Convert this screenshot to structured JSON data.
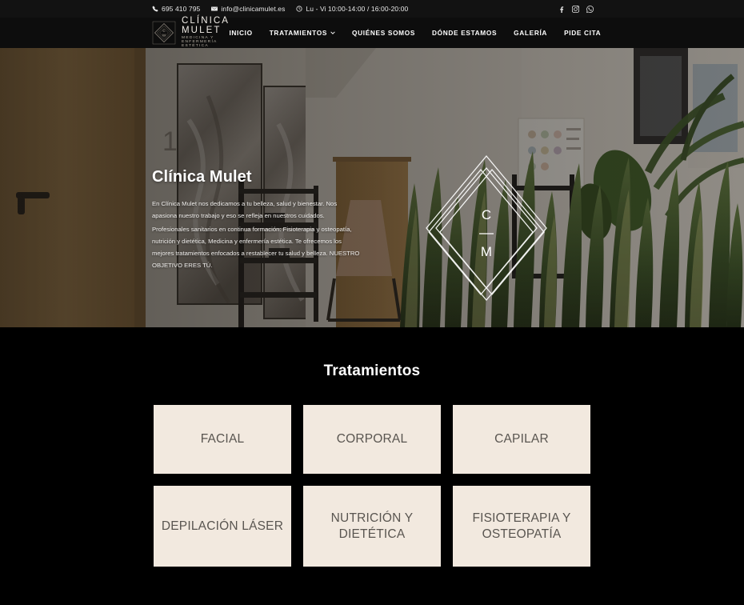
{
  "topbar": {
    "phone": "695 410 795",
    "email": "info@clinicamulet.es",
    "hours": "Lu - Vi 10:00-14:00 / 16:00-20:00",
    "icons": {
      "phone": "phone-icon",
      "email": "envelope-icon",
      "clock": "clock-icon"
    },
    "social": [
      {
        "name": "facebook-icon",
        "label": "Facebook"
      },
      {
        "name": "instagram-icon",
        "label": "Instagram"
      },
      {
        "name": "whatsapp-icon",
        "label": "WhatsApp"
      }
    ]
  },
  "header": {
    "logo_mark": "diamond-logo-icon",
    "brand_title": "CLÍNICA MULET",
    "brand_subtitle": "MEDICINA Y ENFERMERÍA ESTÉTICA",
    "nav": [
      {
        "label": "INICIO",
        "has_dropdown": false
      },
      {
        "label": "TRATAMIENTOS",
        "has_dropdown": true
      },
      {
        "label": "QUIÉNES SOMOS",
        "has_dropdown": false
      },
      {
        "label": "DÓNDE ESTAMOS",
        "has_dropdown": false
      },
      {
        "label": "GALERÍA",
        "has_dropdown": false
      },
      {
        "label": "PIDE CITA",
        "has_dropdown": false
      }
    ]
  },
  "hero": {
    "title": "Clínica Mulet",
    "paragraph1": "En Clínica Mulet nos dedicamos a tu belleza, salud y bienestar. Nos apasiona nuestro trabajo y eso se refleja en nuestros cuidados.",
    "paragraph2": "Profesionales sanitarios en continua formación: Fisioterapia y osteopatía, nutrición y dietética, Medicina y enfermería estética. Te ofrecemos los mejores tratamientos enfocados a restablecer tu salud y belleza. NUESTRO OBJETIVO ERES TÚ.",
    "watermark_letters": {
      "top": "C",
      "bottom": "M"
    },
    "background_description": "Clinic hallway with wooden doors, framed abstract artwork, black shelving and snake plants"
  },
  "treatments": {
    "title": "Tratamientos",
    "cards": [
      {
        "label": "FACIAL"
      },
      {
        "label": "CORPORAL"
      },
      {
        "label": "CAPILAR"
      },
      {
        "label": "DEPILACIÓN LÁSER"
      },
      {
        "label": "NUTRICIÓN Y DIETÉTICA"
      },
      {
        "label": "FISIOTERAPIA Y OSTEOPATÍA"
      }
    ]
  },
  "colors": {
    "page_background": "#000000",
    "topbar_background": "#121212",
    "header_background": "#0d0d0d",
    "card_background": "#f2e9df",
    "card_text": "#595550",
    "brand_title": "#f0ece6",
    "brand_subtitle": "#b9b2a6"
  }
}
